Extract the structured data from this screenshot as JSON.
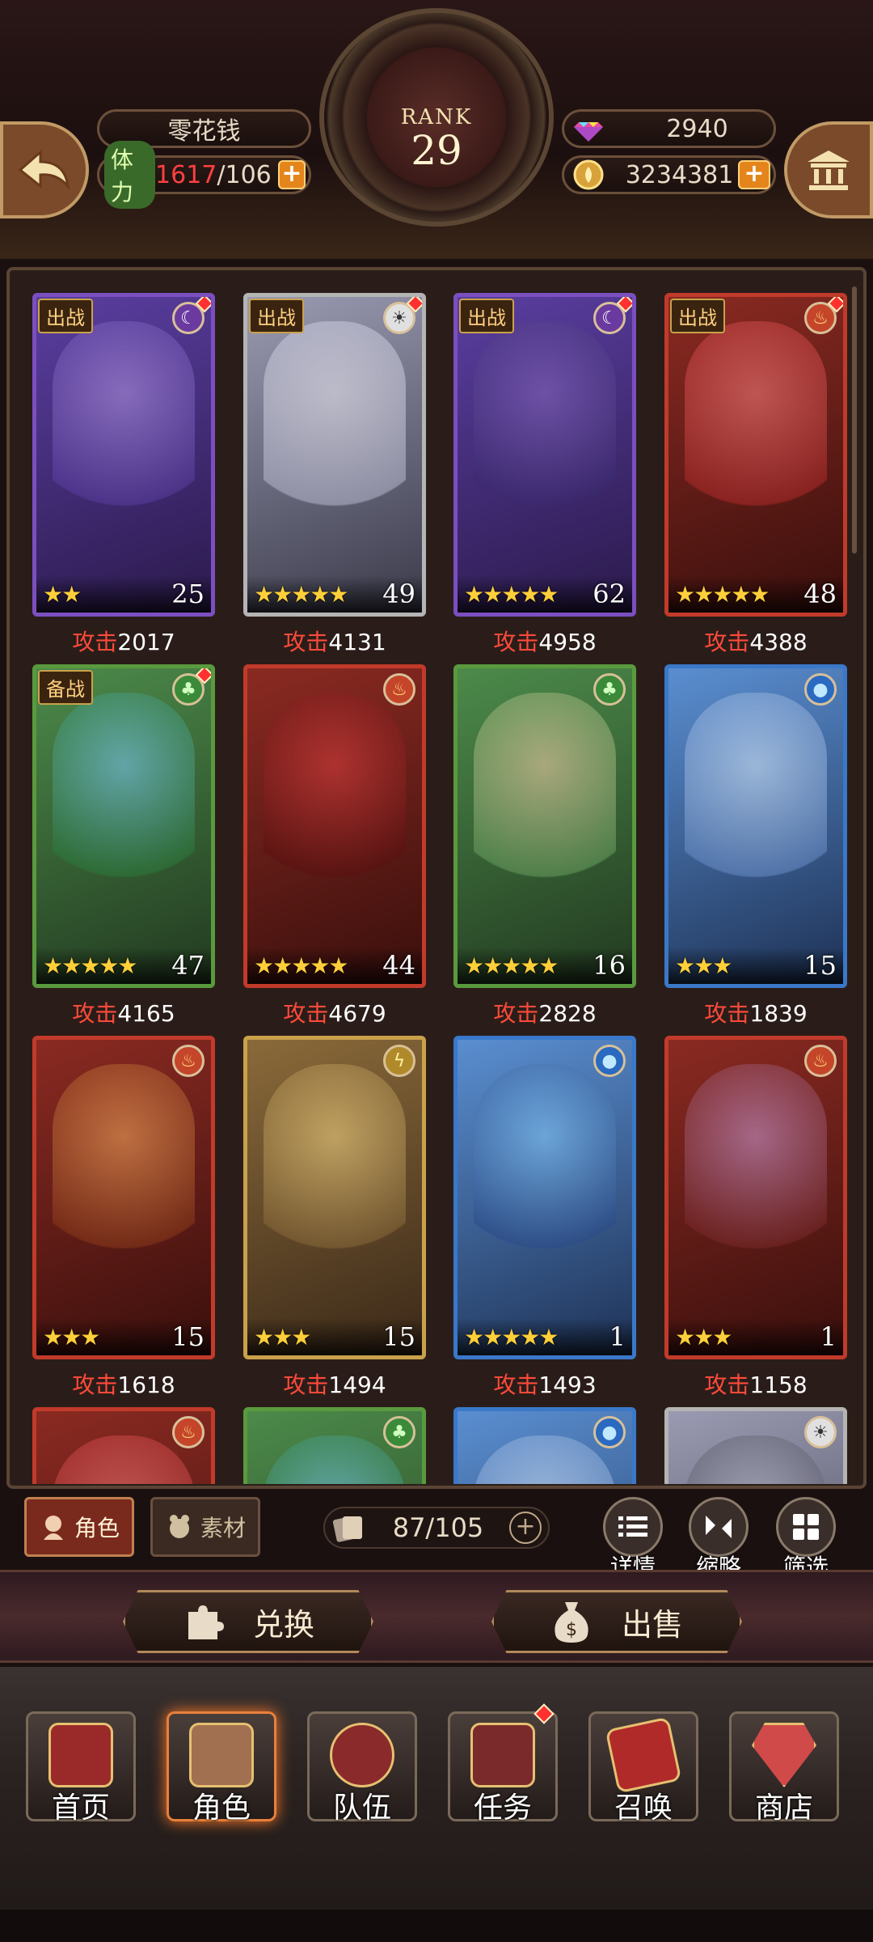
{
  "header": {
    "player_name": "零花钱",
    "stamina_label": "体力",
    "stamina_current": "1617",
    "stamina_max": "/106",
    "rank_label": "RANK",
    "rank_value": "29",
    "gems": "2940",
    "gold": "3234381",
    "icons": {
      "back": "back-arrow-icon",
      "bank": "bank-icon",
      "gem": "gem-icon",
      "coin": "coin-icon",
      "plus": "plus-icon"
    }
  },
  "cards": [
    {
      "tag": "出战",
      "element": "dark",
      "stars": "★★",
      "level": "25",
      "atk_label": "攻击",
      "atk": "2017",
      "has_dot": true
    },
    {
      "tag": "出战",
      "element": "light",
      "stars": "★★★★★",
      "level": "49",
      "atk_label": "攻击",
      "atk": "4131",
      "has_dot": true
    },
    {
      "tag": "出战",
      "element": "dark",
      "stars": "★★★★★",
      "level": "62",
      "atk_label": "攻击",
      "atk": "4958",
      "has_dot": true
    },
    {
      "tag": "出战",
      "element": "fire",
      "stars": "★★★★★",
      "level": "48",
      "atk_label": "攻击",
      "atk": "4388",
      "has_dot": true
    },
    {
      "tag": "备战",
      "element": "wood",
      "stars": "★★★★★",
      "level": "47",
      "atk_label": "攻击",
      "atk": "4165",
      "has_dot": true
    },
    {
      "tag": "",
      "element": "fire",
      "stars": "★★★★★",
      "level": "44",
      "atk_label": "攻击",
      "atk": "4679",
      "has_dot": false
    },
    {
      "tag": "",
      "element": "wood",
      "stars": "★★★★★",
      "level": "16",
      "atk_label": "攻击",
      "atk": "2828",
      "has_dot": false
    },
    {
      "tag": "",
      "element": "water",
      "stars": "★★★",
      "level": "15",
      "atk_label": "攻击",
      "atk": "1839",
      "has_dot": false
    },
    {
      "tag": "",
      "element": "fire",
      "stars": "★★★",
      "level": "15",
      "atk_label": "攻击",
      "atk": "1618",
      "has_dot": false
    },
    {
      "tag": "",
      "element": "thunder",
      "stars": "★★★",
      "level": "15",
      "atk_label": "攻击",
      "atk": "1494",
      "has_dot": false
    },
    {
      "tag": "",
      "element": "water",
      "stars": "★★★★★",
      "level": "1",
      "atk_label": "攻击",
      "atk": "1493",
      "has_dot": false
    },
    {
      "tag": "",
      "element": "fire",
      "stars": "★★★",
      "level": "1",
      "atk_label": "攻击",
      "atk": "1158",
      "has_dot": false
    }
  ],
  "toolbar": {
    "tab_roles": "角色",
    "tab_materials": "素材",
    "card_count": "87/105",
    "details": "详情",
    "collapse": "缩略",
    "filter": "筛选"
  },
  "actions": {
    "exchange": "兑换",
    "sell": "出售"
  },
  "nav": {
    "home": "首页",
    "roles": "角色",
    "team": "队伍",
    "quests": "任务",
    "summon": "召唤",
    "shop": "商店"
  }
}
